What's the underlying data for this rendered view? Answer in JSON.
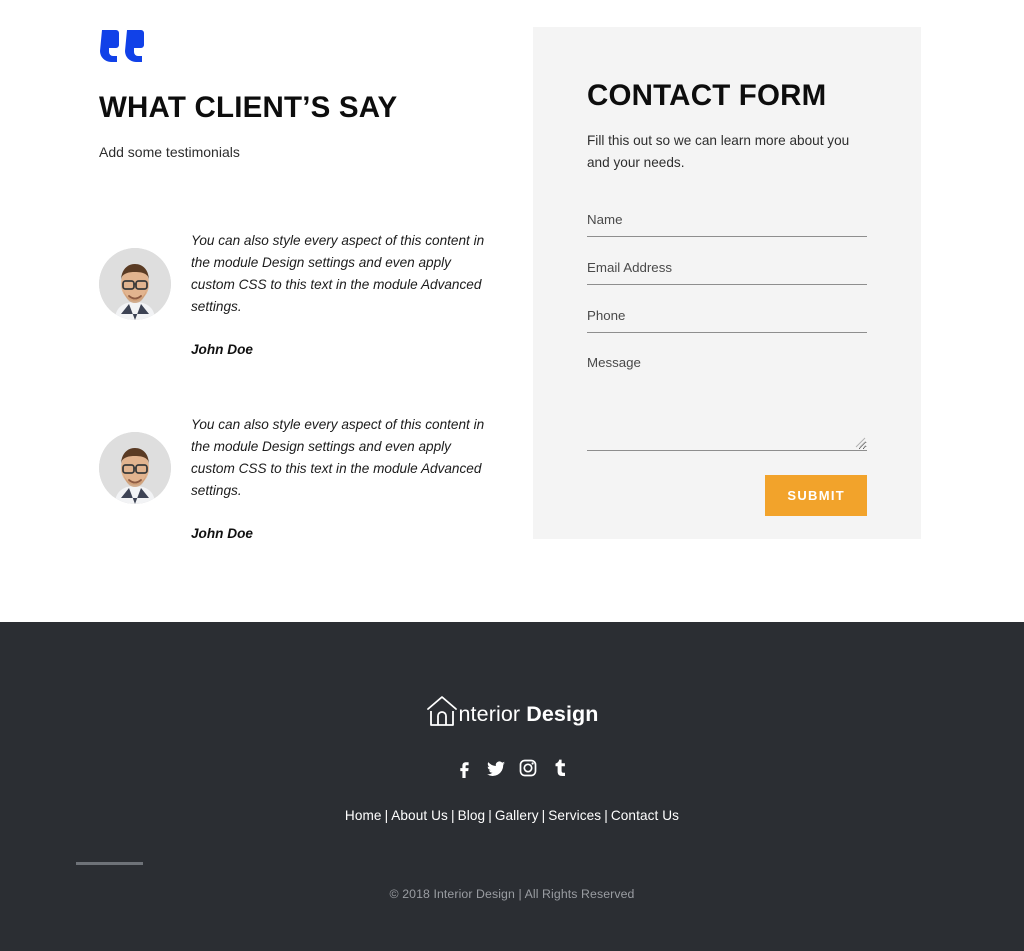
{
  "testimonials_section": {
    "quote_icon": "quote-mark-icon",
    "title": "WHAT CLIENT’S SAY",
    "subtitle": "Add some testimonials",
    "items": [
      {
        "avatar": "avatar-man-with-glasses",
        "text": "You can also style every aspect of this content in the module Design settings and even apply custom CSS to this text in the module Advanced settings.",
        "name": "John Doe"
      },
      {
        "avatar": "avatar-man-with-glasses",
        "text": "You can also style every aspect of this content in the module Design settings and even apply custom CSS to this text in the module Advanced settings.",
        "name": "John Doe"
      }
    ]
  },
  "contact_form": {
    "title": "CONTACT FORM",
    "description": "Fill this out so we can learn more about you and your needs.",
    "fields": [
      {
        "name": "name",
        "placeholder": "Name",
        "value": ""
      },
      {
        "name": "email",
        "placeholder": "Email Address",
        "value": ""
      },
      {
        "name": "phone",
        "placeholder": "Phone",
        "value": ""
      },
      {
        "name": "message",
        "placeholder": "Message",
        "value": ""
      }
    ],
    "submit_label": "SUBMIT",
    "submit_color": "#f2a32b",
    "panel_background": "#f4f4f4"
  },
  "footer": {
    "background": "#2b2e33",
    "logo": {
      "icon": "house-icon",
      "text_light": "nterior ",
      "text_bold": "Design"
    },
    "socials": [
      {
        "name": "facebook",
        "glyph": "facebook-icon"
      },
      {
        "name": "twitter",
        "glyph": "twitter-icon"
      },
      {
        "name": "instagram",
        "glyph": "instagram-icon"
      },
      {
        "name": "tumblr",
        "glyph": "tumblr-icon"
      }
    ],
    "nav": [
      "Home",
      "About Us",
      "Blog",
      "Gallery",
      "Services",
      "Contact Us"
    ],
    "nav_separator": "|",
    "copyright": "© 2018 Interior Design | All Rights Reserved"
  }
}
